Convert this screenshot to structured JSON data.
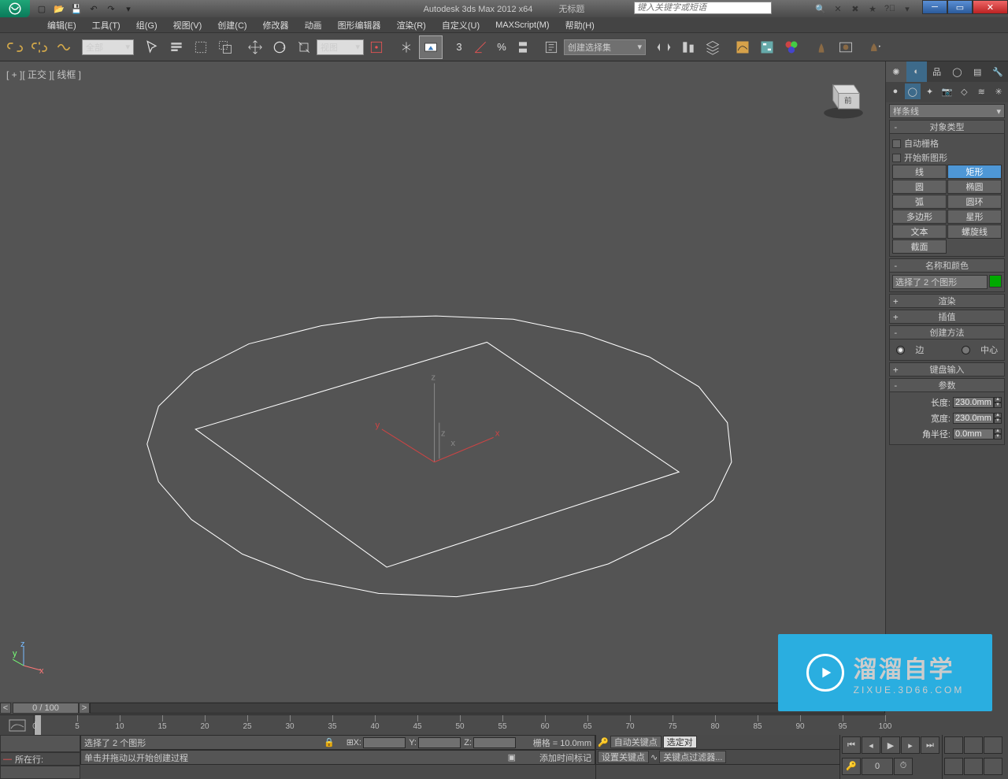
{
  "title": {
    "app": "Autodesk 3ds Max  2012 x64",
    "doc": "无标题"
  },
  "search": {
    "placeholder": "键入关键字或短语"
  },
  "menu": {
    "items": [
      "编辑(E)",
      "工具(T)",
      "组(G)",
      "视图(V)",
      "创建(C)",
      "修改器",
      "动画",
      "图形编辑器",
      "渲染(R)",
      "自定义(U)",
      "MAXScript(M)",
      "帮助(H)"
    ]
  },
  "toolbar": {
    "filter": "全部",
    "refsys": "视图",
    "named_sel": "创建选择集"
  },
  "viewport": {
    "label": "[ + ][ 正交 ][ 线框 ]"
  },
  "panel": {
    "category": "样条线",
    "rollout_object_type": "对象类型",
    "autogrid": "自动栅格",
    "startnew": "开始新图形",
    "types": [
      "线",
      "矩形",
      "圆",
      "椭圆",
      "弧",
      "圆环",
      "多边形",
      "星形",
      "文本",
      "螺旋线",
      "截面",
      ""
    ],
    "selected_type_index": 1,
    "rollout_name_color": "名称和颜色",
    "name_value": "选择了 2 个图形",
    "rollout_render": "渲染",
    "rollout_interp": "插值",
    "rollout_create_method": "创建方法",
    "method_edge": "边",
    "method_center": "中心",
    "method_sel": "edge",
    "rollout_keyboard": "键盘输入",
    "rollout_params": "参数",
    "params": {
      "length_l": "长度:",
      "length_v": "230.0mm",
      "width_l": "宽度:",
      "width_v": "230.0mm",
      "corner_l": "角半径:",
      "corner_v": "0.0mm"
    }
  },
  "timeslider": {
    "pos": "0 / 100"
  },
  "trackbar": {
    "start": 0,
    "end": 100,
    "step": 5
  },
  "status": {
    "now": "所在行:",
    "msg1": "选择了 2 个图形",
    "msg2": "单击并拖动以开始创建过程",
    "grid": "栅格 = 10.0mm",
    "autokey": "自动关键点",
    "sel_locked": "选定对",
    "setkey": "设置关键点",
    "keyfilter": "关键点过滤器...",
    "addtag": "添加时间标记",
    "frame": "0"
  },
  "watermark": {
    "big": "溜溜自学",
    "small": "ZIXUE.3D66.COM"
  }
}
